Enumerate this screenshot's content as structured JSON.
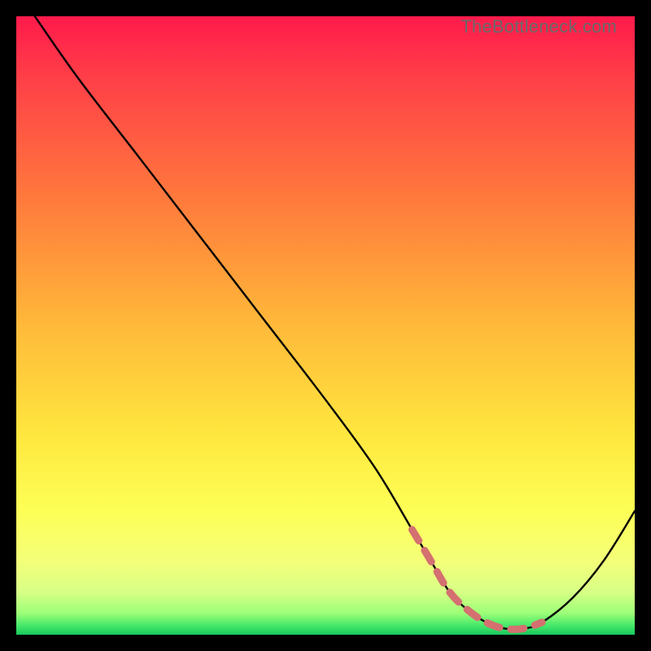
{
  "watermark": "TheBottleneck.com",
  "chart_data": {
    "type": "line",
    "title": "",
    "xlabel": "",
    "ylabel": "",
    "xlim": [
      0,
      100
    ],
    "ylim": [
      0,
      100
    ],
    "grid": false,
    "legend": false,
    "series": [
      {
        "name": "bottleneck-curve",
        "x": [
          3,
          10,
          20,
          30,
          40,
          50,
          58,
          64,
          67,
          70,
          73,
          76,
          79,
          82,
          85,
          90,
          95,
          100
        ],
        "values": [
          100,
          90,
          77,
          64,
          51,
          38,
          27,
          17,
          12,
          7,
          4,
          2,
          1,
          1,
          2,
          6,
          12,
          20
        ]
      }
    ],
    "highlight_region": {
      "name": "optimal-band",
      "x_start": 64,
      "x_end": 87
    },
    "gradient_stops": [
      {
        "offset": 0.0,
        "color": "#ff1a4b"
      },
      {
        "offset": 0.1,
        "color": "#ff3f48"
      },
      {
        "offset": 0.3,
        "color": "#ff7b3c"
      },
      {
        "offset": 0.5,
        "color": "#ffb93a"
      },
      {
        "offset": 0.68,
        "color": "#ffe83f"
      },
      {
        "offset": 0.8,
        "color": "#fdff56"
      },
      {
        "offset": 0.88,
        "color": "#f4ff78"
      },
      {
        "offset": 0.93,
        "color": "#d8ff86"
      },
      {
        "offset": 0.965,
        "color": "#9dff78"
      },
      {
        "offset": 0.985,
        "color": "#46e86a"
      },
      {
        "offset": 1.0,
        "color": "#18c95c"
      }
    ],
    "curve_color": "#000000",
    "highlight_color": "#d47070"
  }
}
